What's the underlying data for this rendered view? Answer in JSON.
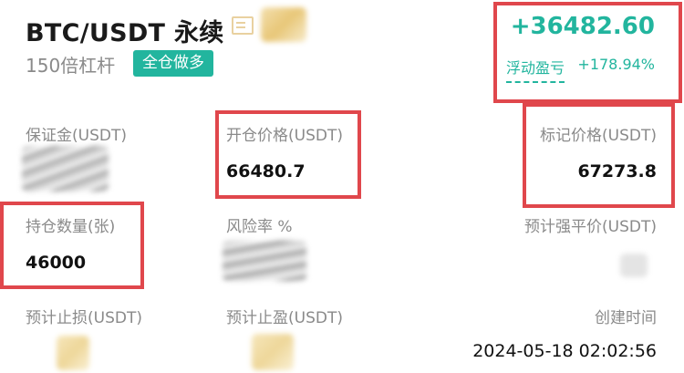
{
  "header": {
    "title": "BTC/USDT 永续",
    "leverage": "150倍杠杆",
    "mode_badge": "全仓做多"
  },
  "pnl": {
    "amount": "+36482.60",
    "label": "浮动盈亏",
    "percent": "+178.94%"
  },
  "fields": {
    "margin": {
      "label": "保证金(USDT)"
    },
    "entry_price": {
      "label": "开仓价格(USDT)",
      "value": "66480.7"
    },
    "mark_price": {
      "label": "标记价格(USDT)",
      "value": "67273.8"
    },
    "position_size": {
      "label": "持仓数量(张)",
      "value": "46000"
    },
    "risk_rate": {
      "label": "风险率 %"
    },
    "est_liq_price": {
      "label": "预计强平价(USDT)"
    },
    "est_stop_loss": {
      "label": "预计止损(USDT)"
    },
    "est_take_profit": {
      "label": "预计止盈(USDT)"
    },
    "created_time": {
      "label": "创建时间",
      "value": "2024-05-18 02:02:56"
    }
  },
  "colors": {
    "accent_green": "#22b59e",
    "highlight_red": "#e0474c",
    "label_gray": "#8a8a8a"
  }
}
